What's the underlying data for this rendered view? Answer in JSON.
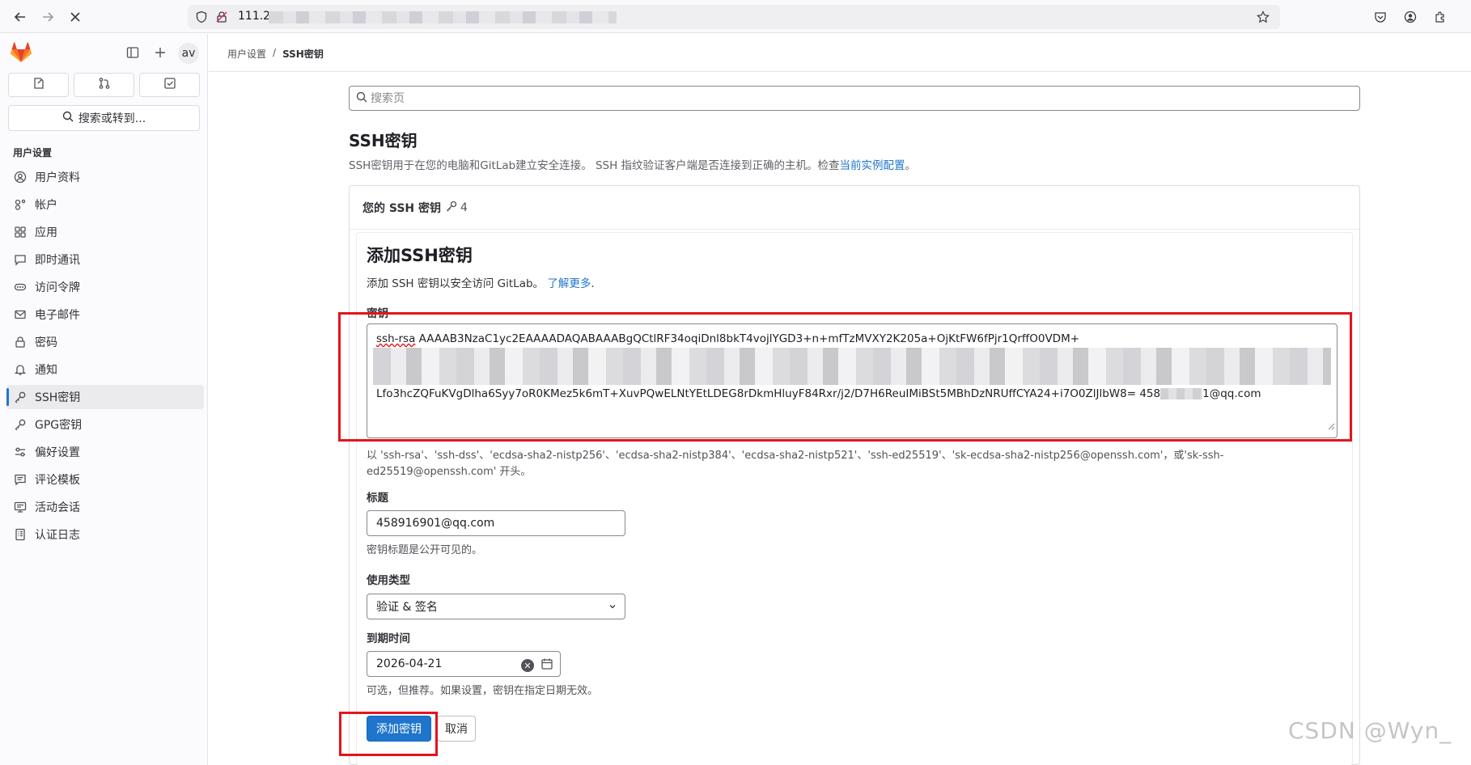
{
  "browser": {
    "url_prefix": "111.2",
    "colors": {
      "chrome_bg": "#f9f9fb",
      "url_bg": "#efeff2"
    }
  },
  "sidebar": {
    "avatar_initials": "av",
    "search_label": "搜索或转到...",
    "section_heading": "用户设置",
    "items": [
      {
        "label": "用户资料",
        "icon": "user-circle-icon"
      },
      {
        "label": "帐户",
        "icon": "account-icon"
      },
      {
        "label": "应用",
        "icon": "applications-icon"
      },
      {
        "label": "即时通讯",
        "icon": "chat-icon"
      },
      {
        "label": "访问令牌",
        "icon": "token-icon"
      },
      {
        "label": "电子邮件",
        "icon": "mail-icon"
      },
      {
        "label": "密码",
        "icon": "lock-icon"
      },
      {
        "label": "通知",
        "icon": "notifications-icon"
      },
      {
        "label": "SSH密钥",
        "icon": "key-icon",
        "active": true
      },
      {
        "label": "GPG密钥",
        "icon": "key-icon"
      },
      {
        "label": "偏好设置",
        "icon": "preferences-icon"
      },
      {
        "label": "评论模板",
        "icon": "comment-template-icon"
      },
      {
        "label": "活动会话",
        "icon": "monitor-icon"
      },
      {
        "label": "认证日志",
        "icon": "log-icon"
      }
    ]
  },
  "breadcrumb": {
    "parent": "用户设置",
    "separator": "/",
    "current": "SSH密钥"
  },
  "page": {
    "search_placeholder": "搜索页",
    "title": "SSH密钥",
    "desc_text": "SSH密钥用于在您的电脑和GitLab建立安全连接。 SSH 指纹验证客户端是否连接到正确的主机。检查",
    "desc_link": "当前实例配置",
    "desc_end": "。"
  },
  "card": {
    "header_title": "您的 SSH 密钥",
    "key_count": "4"
  },
  "form": {
    "title": "添加SSH密钥",
    "desc_text": "添加 SSH 密钥以安全访问 GitLab。 ",
    "desc_link": "了解更多",
    "desc_end": ".",
    "key_label": "密钥",
    "key_line1_prefix": "ssh-rsa",
    "key_line1_rest": " AAAAB3NzaC1yc2EAAAADAQABAAABgQCtlRF34oqiDnl8bkT4vojlYGD3+n+mfTzMVXY2K205a+OjKtFW6fPjr1QrffO0VDM+",
    "key_line3_start": "Lfo3hcZQFuKVgDlha6Syy7oR0KMez5k6mT+XuvPQwELNtYEtLDEG8rDkmHluyF84Rxr/j2/D7H6ReuIMiBSt5MBhDzNRUffCYA24+i7O0ZlJlbW8= 458",
    "key_line3_end": "1@qq.com",
    "key_help": "以 'ssh-rsa'、'ssh-dss'、'ecdsa-sha2-nistp256'、'ecdsa-sha2-nistp384'、'ecdsa-sha2-nistp521'、'ssh-ed25519'、'sk-ecdsa-sha2-nistp256@openssh.com'，或'sk-ssh-ed25519@openssh.com' 开头。",
    "title_label": "标题",
    "title_value": "458916901@qq.com",
    "title_help": "密钥标题是公开可见的。",
    "usage_label": "使用类型",
    "usage_value": "验证 & 签名",
    "expiry_label": "到期时间",
    "expiry_value": "2026-04-21",
    "expiry_help": "可选，但推荐。如果设置，密钥在指定日期无效。",
    "submit_label": "添加密钥",
    "cancel_label": "取消",
    "colors": {
      "primary": "#1f75cb",
      "annotation_red": "#e3141c"
    }
  },
  "watermark": "CSDN @Wyn_"
}
